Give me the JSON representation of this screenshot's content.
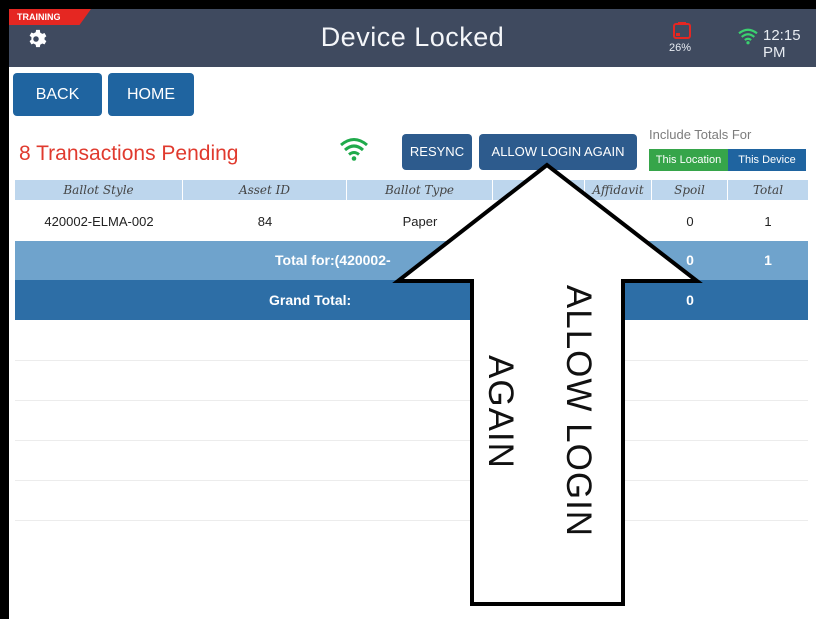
{
  "header": {
    "training_badge": "TRAINING",
    "title": "Device Locked",
    "battery_percent": "26%",
    "time": "12:15 PM"
  },
  "nav": {
    "back_label": "BACK",
    "home_label": "HOME"
  },
  "pending_text": "8 Transactions Pending",
  "actions": {
    "resync_label": "RESYNC",
    "allow_login_label": "ALLOW LOGIN AGAIN"
  },
  "totals_toggle": {
    "label": "Include Totals For",
    "this_location": "This Location",
    "this_device": "This Device"
  },
  "table": {
    "headers": [
      "Ballot Style",
      "Asset ID",
      "Ballot Type",
      "",
      "Affidavit",
      "Spoil",
      "Total"
    ],
    "row": {
      "ballot_style": "420002-ELMA-002",
      "asset_id": "84",
      "ballot_type": "Paper",
      "spoil": "0",
      "total": "1"
    },
    "subtotal": {
      "label": "Total for:(420002-",
      "spoil": "0",
      "total": "1"
    },
    "grand_total": {
      "label": "Grand Total:",
      "spoil": "0"
    }
  },
  "annotation": {
    "line1": "ALLOW LOGIN",
    "line2": "AGAIN"
  },
  "colors": {
    "status_bar": "#3f4a5f",
    "training": "#e52722",
    "button_blue": "#1f64a0",
    "pending_red": "#e03a2e",
    "location_green": "#36a54a",
    "header_row": "#bdd6ed",
    "subtotal_row": "#6fa3cc",
    "grand_row": "#2d6ea6"
  }
}
